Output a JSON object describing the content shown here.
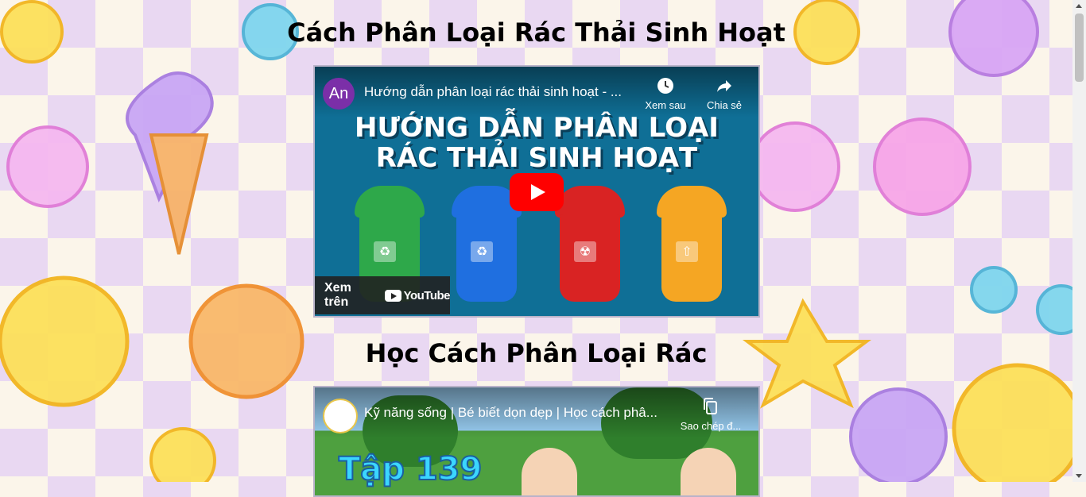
{
  "title1": "Cách Phân Loại Rác Thải Sinh Hoạt",
  "title2": "Học Cách Phân Loại Rác",
  "video1": {
    "channel_initials": "An",
    "title": "Hướng dẫn phân loại rác thải sinh hoạt - ...",
    "watch_later": "Xem sau",
    "share": "Chia sẻ",
    "watch_on": "Xem trên",
    "youtube": "YouTube",
    "banner_line1": "HƯỚNG DẪN PHÂN LOẠI",
    "banner_line2": "RÁC THẢI SINH HOẠT"
  },
  "video2": {
    "title": "Kỹ năng sống | Bé biết dọn dẹp | Học cách phâ...",
    "copy": "Sao chép đ...",
    "episode": "Tập 139"
  },
  "colors": {
    "youtube_red": "#ff0000",
    "bin_green": "#2ea84a",
    "bin_blue": "#1f6fe0",
    "bin_red": "#d92323",
    "bin_orange": "#f5a623"
  },
  "icons": [
    "clock-icon",
    "share-icon",
    "copy-icon",
    "play-icon",
    "youtube-logo-icon"
  ]
}
